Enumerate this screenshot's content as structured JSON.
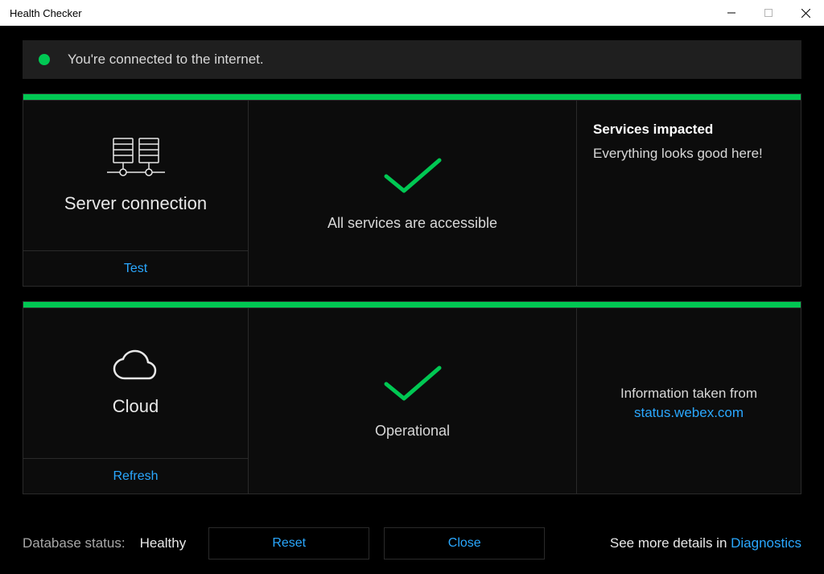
{
  "window": {
    "title": "Health Checker"
  },
  "banner": {
    "text": "You're connected to the internet."
  },
  "panels": {
    "server": {
      "title": "Server connection",
      "button": "Test",
      "mid_text": "All services are accessible",
      "right_heading": "Services impacted",
      "right_body": "Everything looks good here!"
    },
    "cloud": {
      "title": "Cloud",
      "button": "Refresh",
      "mid_text": "Operational",
      "right_info": "Information taken from",
      "right_link": "status.webex.com"
    }
  },
  "footer": {
    "db_label": "Database status:",
    "db_value": "Healthy",
    "reset": "Reset",
    "close": "Close",
    "details_prefix": "See more details in ",
    "details_link": "Diagnostics"
  }
}
